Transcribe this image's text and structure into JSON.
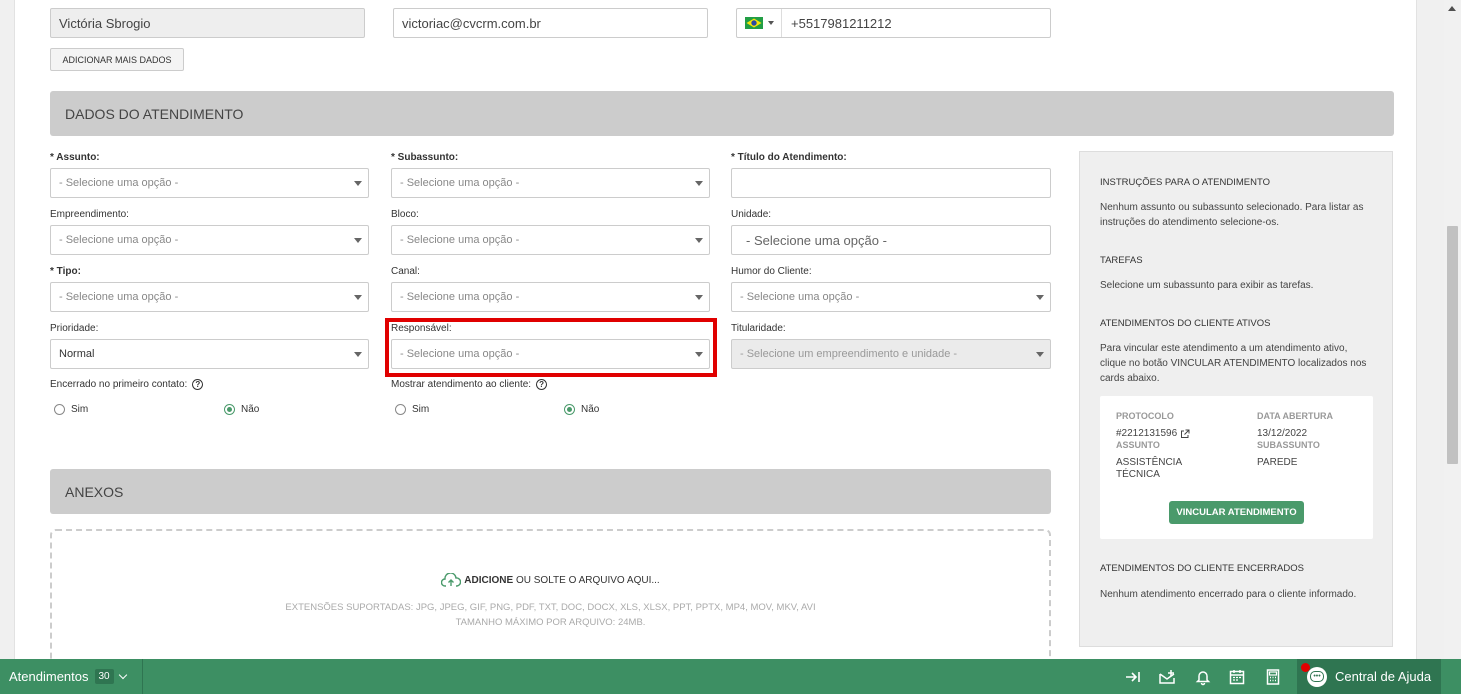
{
  "contact": {
    "name": "Victória Sbrogio",
    "email": "victoriac@cvcrm.com.br",
    "phone": "+5517981211212",
    "add_more_button": "ADICIONAR MAIS DADOS"
  },
  "section_atendimento": {
    "title": "DADOS DO ATENDIMENTO",
    "fields": {
      "assunto": {
        "label": "* Assunto:",
        "value": "- Selecione uma opção -"
      },
      "subassunto": {
        "label": "* Subassunto:",
        "value": "- Selecione uma opção -"
      },
      "titulo": {
        "label": "* Título do Atendimento:",
        "value": ""
      },
      "empreendimento": {
        "label": "Empreendimento:",
        "value": "- Selecione uma opção -"
      },
      "bloco": {
        "label": "Bloco:",
        "value": "- Selecione uma opção -"
      },
      "unidade": {
        "label": "Unidade:",
        "value": "- Selecione uma opção -"
      },
      "tipo": {
        "label": "* Tipo:",
        "value": "- Selecione uma opção -"
      },
      "canal": {
        "label": "Canal:",
        "value": "- Selecione uma opção -"
      },
      "humor": {
        "label": "Humor do Cliente:",
        "value": "- Selecione uma opção -"
      },
      "prioridade": {
        "label": "Prioridade:",
        "value": "Normal"
      },
      "responsavel": {
        "label": "Responsável:",
        "value": "- Selecione uma opção -"
      },
      "titularidade": {
        "label": "Titularidade:",
        "value": "- Selecione um empreendimento e unidade -"
      }
    },
    "encerrado": {
      "label": "Encerrado no primeiro contato:",
      "help": "?",
      "yes": "Sim",
      "no": "Não",
      "selected": "Não"
    },
    "mostrar": {
      "label": "Mostrar atendimento ao cliente:",
      "help": "?",
      "yes": "Sim",
      "no": "Não",
      "selected": "Não"
    }
  },
  "section_anexos": {
    "title": "ANEXOS",
    "add_bold": "ADICIONE",
    "add_rest": " OU SOLTE O ARQUIVO AQUI...",
    "extensions": "EXTENSÕES SUPORTADAS: JPG, JPEG, GIF, PNG, PDF, TXT, DOC, DOCX, XLS, XLSX, PPT, PPTX, MP4, MOV, MKV, AVI",
    "max_size": "TAMANHO MÁXIMO POR ARQUIVO: 24MB."
  },
  "side_panel": {
    "instrucoes_title": "INSTRUÇÕES PARA O ATENDIMENTO",
    "instrucoes_text": "Nenhum assunto ou subassunto selecionado. Para listar as instruções do atendimento selecione-os.",
    "tarefas_title": "TAREFAS",
    "tarefas_text": "Selecione um subassunto para exibir as tarefas.",
    "ativos_title": "ATENDIMENTOS DO CLIENTE ATIVOS",
    "ativos_text": "Para vincular este atendimento a um atendimento ativo, clique no botão VINCULAR ATENDIMENTO localizados nos cards abaixo.",
    "card": {
      "protocolo_label": "PROTOCOLO",
      "protocolo_value": "#2212131596",
      "data_label": "DATA ABERTURA",
      "data_value": "13/12/2022",
      "assunto_label": "ASSUNTO",
      "assunto_value": "ASSISTÊNCIA TÉCNICA",
      "subassunto_label": "SUBASSUNTO",
      "subassunto_value": "PAREDE",
      "button": "VINCULAR ATENDIMENTO"
    },
    "encerrados_title": "ATENDIMENTOS DO CLIENTE ENCERRADOS",
    "encerrados_text": "Nenhum atendimento encerrado para o cliente informado."
  },
  "bottom_bar": {
    "atendimentos_label": "Atendimentos",
    "atendimentos_count": "30",
    "help_center": "Central de Ajuda"
  },
  "colors": {
    "accent": "#4a9a6b",
    "highlight": "#e00000",
    "header_bg": "#cccccc"
  }
}
